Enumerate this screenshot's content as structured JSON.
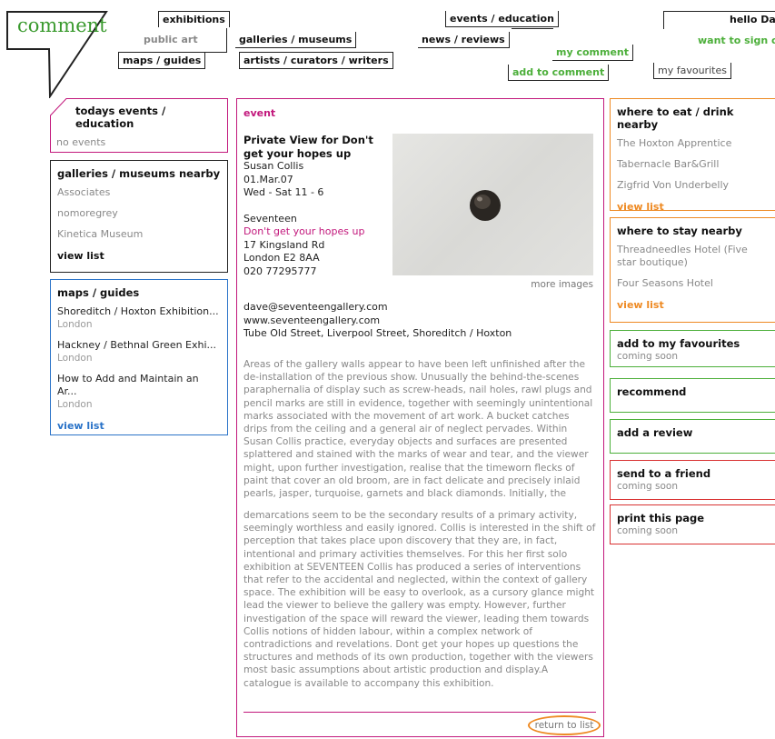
{
  "header": {
    "logo": "comment",
    "nav": {
      "exhibitions": "exhibitions",
      "public_art": "public art",
      "maps_guides": "maps / guides",
      "galleries_museums": "galleries / museums",
      "artists": "artists / curators / writers",
      "events_education": "events / education",
      "news_reviews": "news / reviews",
      "my_comment": "my comment",
      "add_to_comment": "add to comment",
      "hello": "hello Da",
      "sign_out": "want to sign o",
      "my_favourites": "my favourites"
    }
  },
  "left": {
    "todays": {
      "title": "todays events / education",
      "empty": "no events"
    },
    "galleries": {
      "title": "galleries / museums nearby",
      "items": [
        "Associates",
        "nomoregrey",
        "Kinetica Museum"
      ],
      "view_list": "view list"
    },
    "maps": {
      "title": "maps / guides",
      "items": [
        {
          "name": "Shoreditch / Hoxton Exhibition...",
          "place": "London"
        },
        {
          "name": "Hackney / Bethnal Green Exhi...",
          "place": "London"
        },
        {
          "name": "How to Add and Maintain an Ar...",
          "place": "London"
        }
      ],
      "view_list": "view list"
    }
  },
  "event": {
    "label": "event",
    "title": "Private View for Don't get your hopes up",
    "artist": "Susan Collis",
    "date": "01.Mar.07",
    "hours": "Wed - Sat 11 - 6",
    "venue": "Seventeen",
    "exhibition": "Don't get your hopes up",
    "address1": "17 Kingsland Rd",
    "address2": "London E2 8AA",
    "phone": "020 77295777",
    "more_images": "more images",
    "email": "dave@seventeengallery.com",
    "web": "www.seventeengallery.com",
    "tube": "Tube Old Street, Liverpool Street, Shoreditch / Hoxton",
    "body1": "Areas of the gallery walls appear to have been left unfinished after the de-installation of the previous show. Unusually the behind-the-scenes paraphernalia of display such as screw-heads, nail holes, rawl plugs and pencil marks are still in evidence, together with seemingly unintentional marks associated with the movement of art work. A bucket catches drips from the ceiling and a general air of neglect pervades. Within Susan Collis practice, everyday objects and surfaces are presented splattered and stained with the marks of wear and tear, and the viewer might, upon further investigation, realise that the timeworn flecks of paint that cover an old broom, are in fact delicate and precisely inlaid pearls, jasper, turquoise, garnets and black diamonds. Initially, the",
    "body2": "demarcations seem to be the secondary results of a primary activity, seemingly worthless and easily ignored. Collis is interested in the shift of perception that takes place upon discovery that they are, in fact, intentional and primary activities themselves. For this her first solo exhibition at SEVENTEEN Collis has produced a series of interventions that refer to the accidental and neglected, within the context of gallery space. The exhibition will be easy to overlook, as a cursory glance might lead the viewer to believe the gallery was empty. However, further investigation of the space will reward the viewer, leading them towards Collis notions of hidden labour, within a complex network of contradictions and revelations. Dont get your hopes up questions the structures and methods of its own production, together with the viewers most basic assumptions about artistic production and display.A catalogue is available to accompany this exhibition.",
    "return": "return to list"
  },
  "right": {
    "eat": {
      "title": "where to eat / drink nearby",
      "items": [
        "The Hoxton Apprentice",
        "Tabernacle Bar&Grill",
        "Zigfrid Von Underbelly"
      ],
      "view_list": "view list"
    },
    "stay": {
      "title": "where to stay nearby",
      "items": [
        "Threadneedles Hotel (Five star boutique)",
        "Four Seasons Hotel"
      ],
      "view_list": "view list"
    },
    "favourites": {
      "title": "add to my favourites",
      "note": "coming soon"
    },
    "recommend": {
      "title": "recommend"
    },
    "review": {
      "title": "add a review"
    },
    "send": {
      "title": "send to a friend",
      "note": "coming soon"
    },
    "print": {
      "title": "print this page",
      "note": "coming soon"
    }
  },
  "colors": {
    "magenta": "#c2187c",
    "green": "#4caf3a",
    "orange": "#ee8a23",
    "blue": "#2a73c8",
    "red": "#d93232"
  }
}
